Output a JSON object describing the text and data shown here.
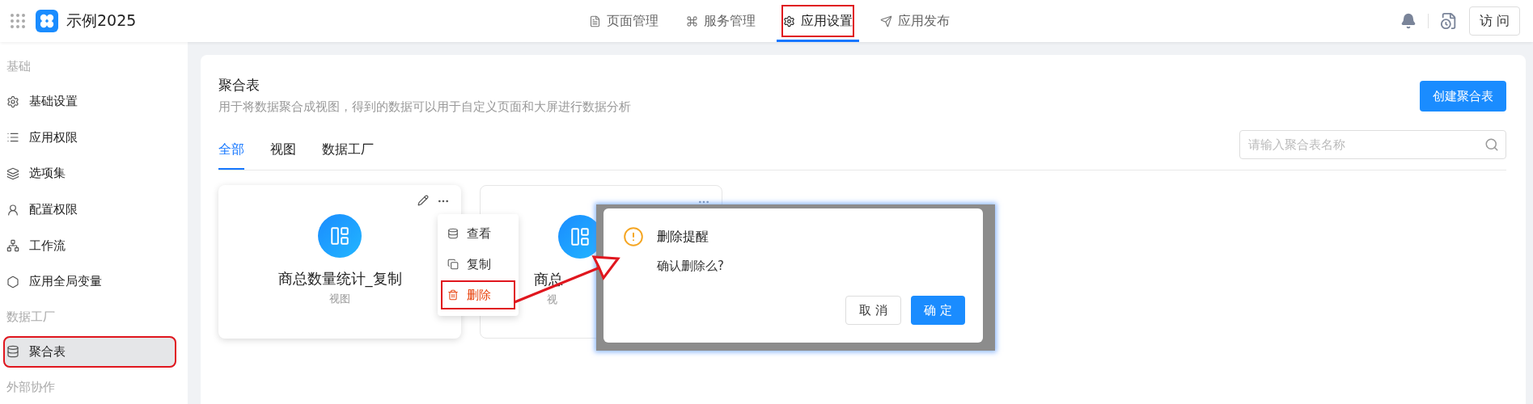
{
  "app": {
    "name": "示例2025"
  },
  "nav": [
    {
      "label": "页面管理",
      "selected": false,
      "annotated": false
    },
    {
      "label": "服务管理",
      "selected": false,
      "annotated": false
    },
    {
      "label": "应用设置",
      "selected": true,
      "annotated": true
    },
    {
      "label": "应用发布",
      "selected": false,
      "annotated": false
    }
  ],
  "header": {
    "visit_button": "访 问"
  },
  "sidebar": [
    {
      "title": "基础",
      "items": [
        {
          "label": "基础设置",
          "selected": false,
          "annotated": false
        },
        {
          "label": "应用权限",
          "selected": false,
          "annotated": false
        },
        {
          "label": "选项集",
          "selected": false,
          "annotated": false
        },
        {
          "label": "配置权限",
          "selected": false,
          "annotated": false
        },
        {
          "label": "工作流",
          "selected": false,
          "annotated": false
        },
        {
          "label": "应用全局变量",
          "selected": false,
          "annotated": false
        }
      ]
    },
    {
      "title": "数据工厂",
      "items": [
        {
          "label": "聚合表",
          "selected": true,
          "annotated": true
        }
      ]
    },
    {
      "title": "外部协作"
    }
  ],
  "page": {
    "title": "聚合表",
    "description": "用于将数据聚合成视图，得到的数据可以用于自定义页面和大屏进行数据分析",
    "create_button": "创建聚合表",
    "tabs": [
      {
        "label": "全部",
        "selected": true
      },
      {
        "label": "视图",
        "selected": false
      },
      {
        "label": "数据工厂",
        "selected": false
      }
    ],
    "search": {
      "placeholder": "请输入聚合表名称"
    }
  },
  "cards": [
    {
      "title": "商总数量统计_复制",
      "type": "视图",
      "kind": "full"
    },
    {
      "title": "商总",
      "type": "视",
      "kind": "covered"
    }
  ],
  "context_menu": [
    {
      "label": "查看",
      "kind": "normal",
      "annotated": false
    },
    {
      "label": "复制",
      "kind": "normal",
      "annotated": false
    },
    {
      "label": "删除",
      "kind": "danger",
      "annotated": true
    }
  ],
  "dialog": {
    "title": "删除提醒",
    "message": "确认删除么?",
    "buttons": [
      {
        "label": "取 消",
        "kind": "default"
      },
      {
        "label": "确 定",
        "kind": "primary"
      }
    ]
  }
}
